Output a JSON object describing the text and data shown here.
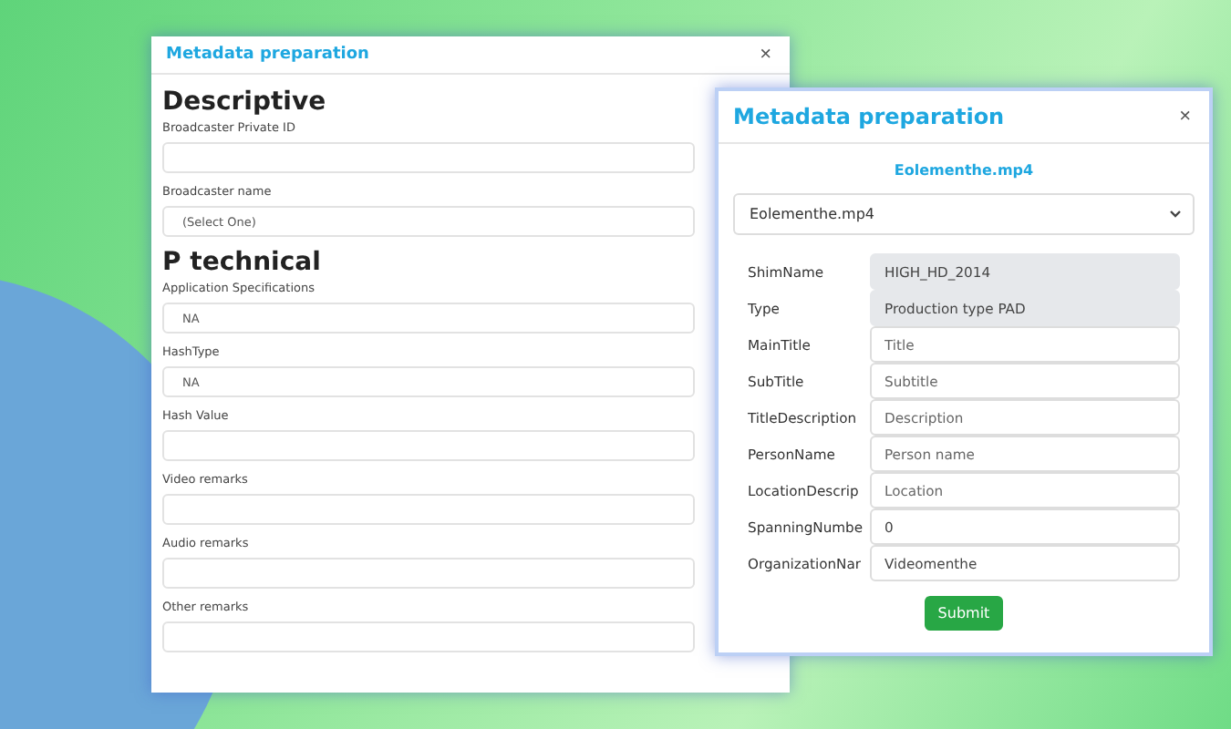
{
  "back_dialog": {
    "title": "Metadata preparation",
    "close": "×",
    "items": [
      {
        "kind": "heading",
        "text": "Descriptive"
      },
      {
        "kind": "input",
        "label": "Broadcaster Private ID"
      },
      {
        "kind": "select",
        "label": "Broadcaster name",
        "value": "(Select One)"
      },
      {
        "kind": "heading",
        "text": "P technical"
      },
      {
        "kind": "input",
        "label": "Application Specifications",
        "value": "NA"
      },
      {
        "kind": "input",
        "label": "HashType",
        "value": "NA"
      },
      {
        "kind": "input",
        "label": "Hash Value"
      },
      {
        "kind": "input",
        "label": "Video remarks"
      },
      {
        "kind": "input",
        "label": "Audio remarks"
      },
      {
        "kind": "input",
        "label": "Other remarks"
      }
    ]
  },
  "front_dialog": {
    "title": "Metadata preparation",
    "close": "×",
    "file_name": "Eolementhe.mp4",
    "file_select": "Eolementhe.mp4",
    "fields": [
      {
        "label": "ShimName",
        "value": "HIGH_HD_2014",
        "disabled": true
      },
      {
        "label": "Type",
        "value": "Production type PAD",
        "disabled": true
      },
      {
        "label": "MainTitle",
        "placeholder": "Title",
        "disabled": false
      },
      {
        "label": "SubTitle",
        "placeholder": "Subtitle",
        "disabled": false
      },
      {
        "label": "TitleDescription",
        "placeholder": "Description",
        "disabled": false
      },
      {
        "label": "PersonName",
        "placeholder": "Person name",
        "disabled": false
      },
      {
        "label": "LocationDescrip",
        "placeholder": "Location",
        "disabled": false
      },
      {
        "label": "SpanningNumbe",
        "value": "0",
        "disabled": false
      },
      {
        "label": "OrganizationNar",
        "value": "Videomenthe",
        "disabled": false
      }
    ],
    "submit": "Submit"
  }
}
